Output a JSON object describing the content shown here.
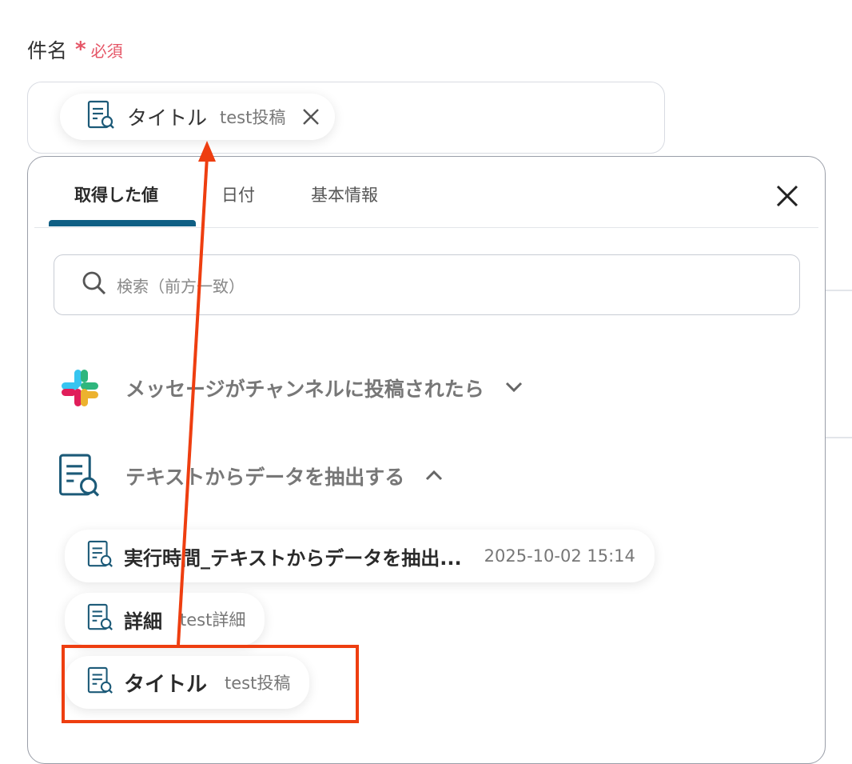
{
  "field": {
    "label": "件名",
    "required_mark": "*",
    "required_text": "必須"
  },
  "selected_chip": {
    "icon": "document-search-icon",
    "label": "タイトル",
    "value": "test投稿",
    "remove_icon": "close-icon"
  },
  "tabs": [
    {
      "label": "取得した値",
      "active": true
    },
    {
      "label": "日付",
      "active": false
    },
    {
      "label": "基本情報",
      "active": false
    }
  ],
  "search": {
    "placeholder": "検索（前方一致）",
    "icon": "search-icon"
  },
  "sections": [
    {
      "title": "メッセージがチャンネルに投稿されたら",
      "icon": "slack-logo-icon",
      "expanded": false
    },
    {
      "title": "テキストからデータを抽出する",
      "icon": "document-search-icon",
      "expanded": true
    }
  ],
  "items": [
    {
      "label": "実行時間_テキストからデータを抽出...",
      "value": "2025-10-02 15:14"
    },
    {
      "label": "詳細",
      "value": "test詳細"
    },
    {
      "label": "タイトル",
      "value": "test投稿"
    }
  ],
  "colors": {
    "accent": "#0f5f84",
    "required": "#e55566",
    "annotation": "#ee3e10",
    "icon": "#1c5a78"
  }
}
